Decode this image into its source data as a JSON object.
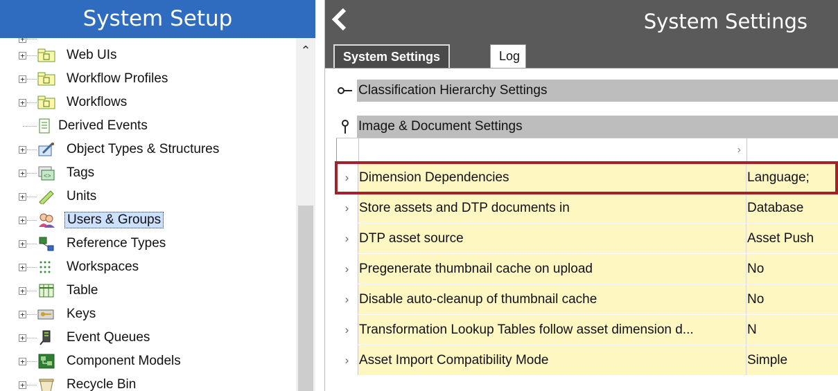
{
  "left_panel": {
    "title": "System Setup",
    "tree_items": [
      {
        "label": "Web UIs",
        "icon": "folder-icon"
      },
      {
        "label": "Workflow Profiles",
        "icon": "folder-icon"
      },
      {
        "label": "Workflows",
        "icon": "folder-icon"
      },
      {
        "label": "Derived Events",
        "icon": "document-icon"
      },
      {
        "label": "Object Types & Structures",
        "icon": "object-types-icon"
      },
      {
        "label": "Tags",
        "icon": "tags-icon"
      },
      {
        "label": "Units",
        "icon": "ruler-icon"
      },
      {
        "label": "Users & Groups",
        "icon": "users-icon",
        "selected": true
      },
      {
        "label": "Reference Types",
        "icon": "reference-icon"
      },
      {
        "label": "Workspaces",
        "icon": "workspaces-icon"
      },
      {
        "label": "Table",
        "icon": "table-icon"
      },
      {
        "label": "Keys",
        "icon": "keys-icon"
      },
      {
        "label": "Event Queues",
        "icon": "event-queue-icon"
      },
      {
        "label": "Component Models",
        "icon": "component-icon"
      },
      {
        "label": "Recycle Bin",
        "icon": "recycle-bin-icon"
      }
    ]
  },
  "right_panel": {
    "title": "System Settings",
    "tabs": [
      {
        "label": "System Settings",
        "active": true
      },
      {
        "label": "Log",
        "active": false
      }
    ],
    "sections": [
      {
        "label": "Classification Hierarchy Settings",
        "state": "collapsed"
      },
      {
        "label": "Image & Document Settings",
        "state": "expanded"
      }
    ],
    "settings": [
      {
        "name": "Dimension Dependencies",
        "value": "Language;"
      },
      {
        "name": "Store assets and DTP documents in",
        "value": "Database"
      },
      {
        "name": "DTP asset source",
        "value": "Asset Push"
      },
      {
        "name": "Pregenerate thumbnail cache on upload",
        "value": "No"
      },
      {
        "name": "Disable auto-cleanup of thumbnail cache",
        "value": "No"
      },
      {
        "name": "Transformation Lookup Tables follow asset dimension d...",
        "value": "N"
      },
      {
        "name": "Asset Import Compatibility Mode",
        "value": "Simple"
      }
    ]
  },
  "colors": {
    "left_header": "#2f6cc0",
    "right_header": "#5a5a5a",
    "row_fill": "#fff7c2",
    "highlight_border": "#a4202a"
  }
}
